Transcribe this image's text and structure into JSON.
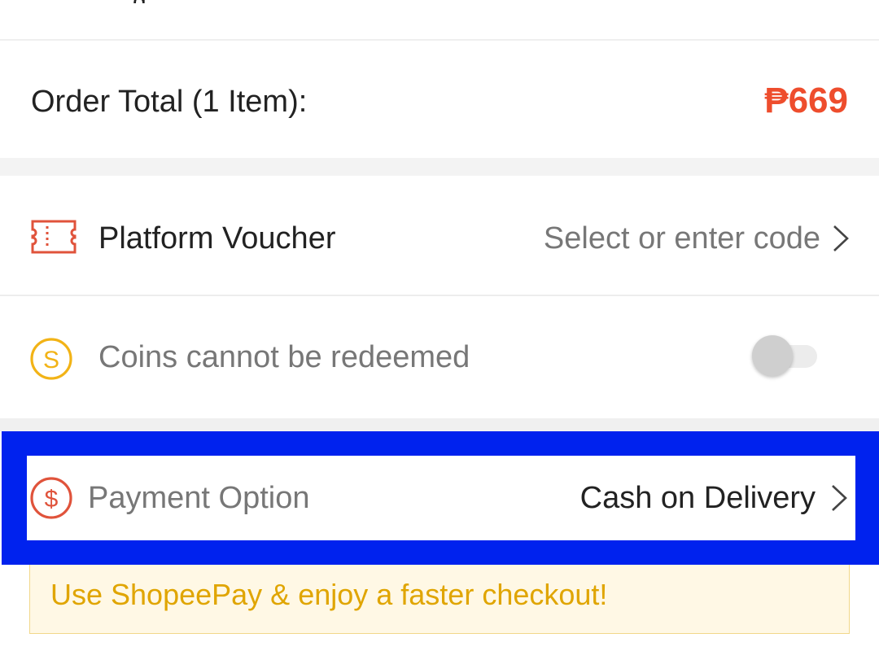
{
  "order_total": {
    "label": "Order Total (1 Item):",
    "amount": "₱669"
  },
  "voucher": {
    "label": "Platform Voucher",
    "value": "Select or enter code",
    "icon": "voucher-ticket-icon"
  },
  "coins": {
    "label": "Coins cannot be redeemed",
    "icon": "coin-s-icon",
    "toggle_on": false
  },
  "payment": {
    "label": "Payment Option",
    "value": "Cash on Delivery",
    "icon": "dollar-circle-icon"
  },
  "promo": {
    "text": "Use ShopeePay & enjoy a faster checkout!"
  },
  "colors": {
    "price": "#ee4d2d",
    "highlight": "#0022ee",
    "coin": "#f2b316",
    "promo_text": "#e0a500",
    "promo_bg": "#fff8e5"
  }
}
